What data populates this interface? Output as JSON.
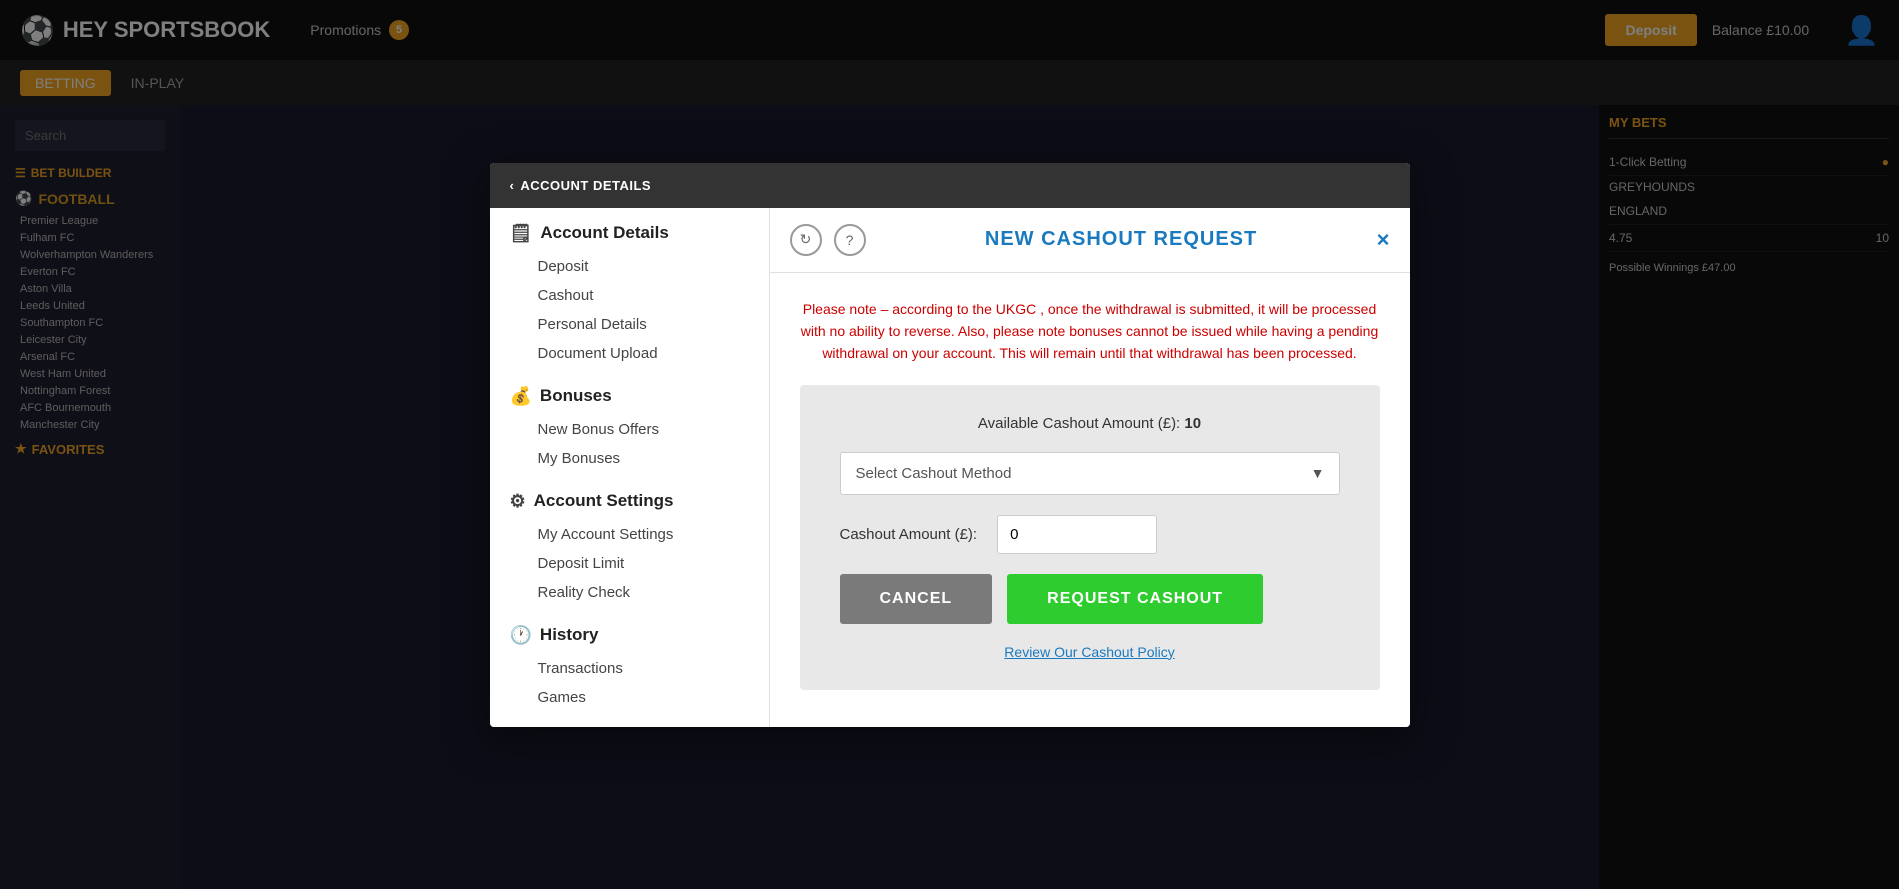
{
  "header": {
    "logo": "HEY SPORTSBOOK",
    "promotions_label": "Promotions",
    "promotions_badge": "5",
    "deposit_label": "Deposit",
    "balance_label": "Balance £10.00"
  },
  "nav": {
    "tabs": [
      {
        "label": "BETTING",
        "active": true
      },
      {
        "label": "IN-PLAY",
        "active": false
      }
    ]
  },
  "sidebar": {
    "search_placeholder": "Search",
    "bet_builder": "BET BUILDER",
    "sports": [
      {
        "name": "FOOTBALL",
        "matches": [
          "Premier League",
          "Fulham FC",
          "Wolverhampton Wanderers",
          "Everton FC",
          "Aston Villa",
          "Leeds United",
          "Southampton FC",
          "Leicester City",
          "Arsenal FC",
          "West Ham United",
          "Nottingham Forest",
          "AFC Bournemouth",
          "Manchester City"
        ]
      }
    ],
    "favorites": "FAVORITES"
  },
  "right_panel": {
    "my_bets_label": "MY BETS",
    "one_click_label": "1-Click Betting",
    "greyhounds_label": "GREYHOUNDS",
    "england_label": "ENGLAND",
    "score": "4.75",
    "value": "10",
    "possible_winnings": "Possible Winnings £47.00"
  },
  "modal": {
    "back_label": "ACCOUNT DETAILS",
    "close_icon": "×",
    "header_icons": [
      "↻",
      "?"
    ],
    "title": "NEW CASHOUT REQUEST",
    "warning": "Please note – according to the UKGC , once the withdrawal is submitted, it will be processed with no ability to reverse. Also, please note bonuses cannot be issued while having a pending withdrawal on your account. This will remain until that withdrawal has been processed.",
    "available_label": "Available Cashout Amount (£):",
    "available_value": "10",
    "select_placeholder": "Select Cashout Method",
    "amount_label": "Cashout Amount (£):",
    "amount_value": "0",
    "cancel_label": "CANCEL",
    "request_label": "REQUEST CASHOUT",
    "policy_link": "Review Our Cashout Policy",
    "nav": {
      "account_details": {
        "title": "Account Details",
        "icon": "🗒",
        "items": [
          "Deposit",
          "Cashout",
          "Personal Details",
          "Document Upload"
        ]
      },
      "bonuses": {
        "title": "Bonuses",
        "icon": "💰",
        "items": [
          "New Bonus Offers",
          "My Bonuses"
        ]
      },
      "account_settings": {
        "title": "Account Settings",
        "icon": "⚙",
        "items": [
          "My Account Settings",
          "Deposit Limit",
          "Reality Check"
        ]
      },
      "history": {
        "title": "History",
        "icon": "🕐",
        "items": [
          "Transactions",
          "Games"
        ]
      }
    }
  }
}
